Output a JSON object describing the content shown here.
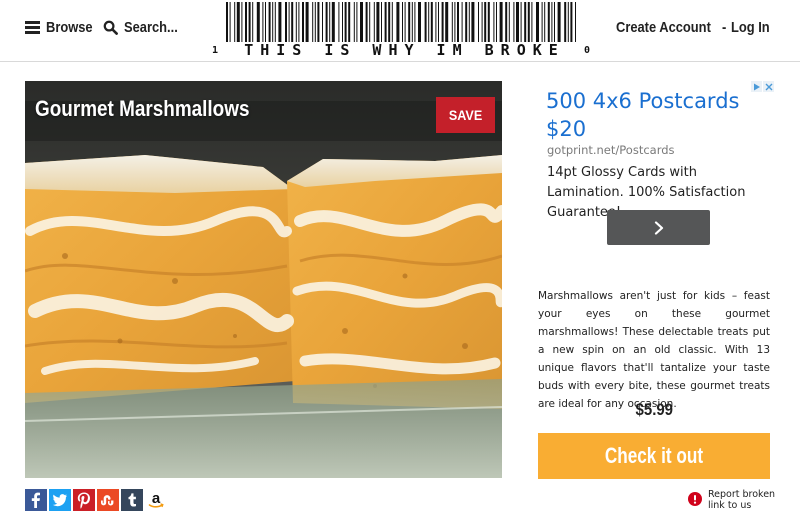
{
  "header": {
    "browse_label": "Browse",
    "search_label": "Search...",
    "logo_text": "THIS IS WHY IM BROKE",
    "logo_left_digit": "1",
    "logo_right_digit": "0",
    "create_account_label": "Create Account",
    "separator": "-",
    "login_label": "Log In"
  },
  "product": {
    "title": "Gourmet Marshmallows",
    "save_label": "SAVE",
    "description": "Marshmallows aren't just for kids – feast your eyes on these gourmet marshmallows! These delectable treats put a new spin on an old classic. With 13 unique flavors that'll tantalize your taste buds with every bite, these gourmet treats are ideal for any occasion.",
    "price": "$5.99",
    "cta_label": "Check it out"
  },
  "ad": {
    "headline": "500 4x6 Postcards $20",
    "display_url": "gotprint.net/Postcards",
    "body": "14pt Glossy Cards with Lamination. 100% Satisfaction Guarantee!",
    "button_icon": "chevron-right-icon"
  },
  "share": {
    "icons": [
      "facebook-icon",
      "twitter-icon",
      "pinterest-icon",
      "stumbleupon-icon",
      "tumblr-icon",
      "amazon-icon"
    ]
  },
  "report": {
    "label": "Report broken link to us",
    "icon": "alert-icon"
  },
  "colors": {
    "save_red": "#c4202a",
    "cta_orange": "#f9ad33",
    "ad_link_blue": "#1a6fd0",
    "ad_button_gray": "#555657",
    "facebook": "#3b5998",
    "twitter": "#1da1f2",
    "pinterest": "#cb2027",
    "stumbleupon": "#eb4924",
    "tumblr": "#35465c",
    "alert_red": "#d0021b"
  }
}
